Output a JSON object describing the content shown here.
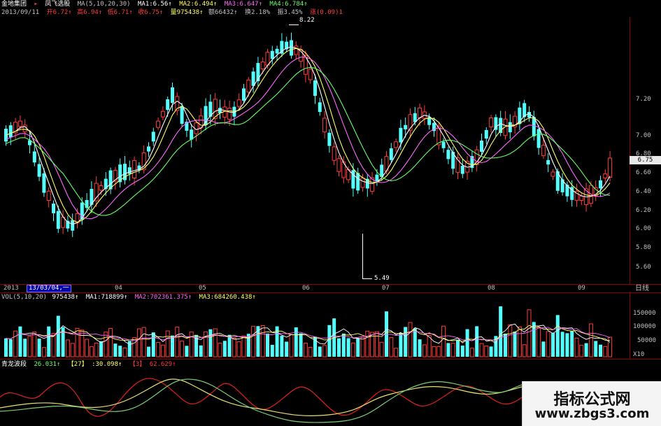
{
  "header": {
    "stock_name": "金地集团",
    "indicator_name": "凤飞选股",
    "ma_params": "MA(5,10,20,30)",
    "ma1": "MA1:6.56↑",
    "ma2": "MA2:6.494↑",
    "ma3": "MA3:6.647↑",
    "ma4": "MA4:6.784↑",
    "date": "2013/09/11",
    "open": "开6.72↑",
    "high": "高6.94↑",
    "low": "低6.71↑",
    "close": "收6.75↑",
    "volume": "量975438↑",
    "amount": "额66432↑",
    "turnover": "换2.18%",
    "amplitude": "振3.45%",
    "change": "涨(0.09)1"
  },
  "price_axis": {
    "labels": [
      "7.20",
      "7.00",
      "6.80",
      "6.60",
      "6.40",
      "6.20",
      "6.00",
      "5.80",
      "5.60"
    ],
    "current_price": "6.75"
  },
  "markers": {
    "high_label": "8.22",
    "low_label": "5.49"
  },
  "time_axis": {
    "year": "2013",
    "cursor_date": "13/03/04,一",
    "months": [
      "04",
      "05",
      "06",
      "07",
      "08",
      "09"
    ],
    "right_label": "日线"
  },
  "volume": {
    "title": "VOL(5,10,20)",
    "value": "975438↑",
    "ma1": "MA1:718899↑",
    "ma2": "MA2:702361.375↑",
    "ma3": "MA3:684260.438↑",
    "axis_labels": [
      "150000",
      "100000",
      "50000"
    ],
    "unit": "X10"
  },
  "oscillator": {
    "title": "青龙波段",
    "v1": "26.031↑",
    "v2": "【27】",
    "v3": ":30.098↑",
    "v4": "【3】",
    "v5": "62.629↑"
  },
  "watermark": {
    "title": "指标公式网",
    "url": "www.zbgs3.com"
  },
  "colors": {
    "up": "#ff3b3b",
    "down": "#54ffff",
    "ma1": "#ffffff",
    "ma2": "#ffff66",
    "ma3": "#ff66ff",
    "ma4": "#66ff66"
  }
}
